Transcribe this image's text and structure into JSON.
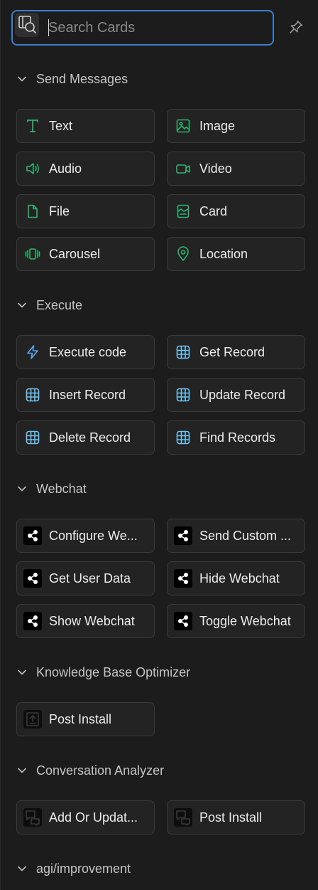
{
  "search": {
    "placeholder": "Search Cards",
    "value": ""
  },
  "colors": {
    "accent_blue": "#3b7fd1",
    "icon_green": "#2fb371",
    "icon_blue": "#5aa9f5",
    "icon_cyan": "#6ec6f5"
  },
  "sections": [
    {
      "title": "Send Messages",
      "cards": [
        {
          "label": "Text",
          "icon": "text-icon"
        },
        {
          "label": "Image",
          "icon": "image-icon"
        },
        {
          "label": "Audio",
          "icon": "audio-icon"
        },
        {
          "label": "Video",
          "icon": "video-icon"
        },
        {
          "label": "File",
          "icon": "file-icon"
        },
        {
          "label": "Card",
          "icon": "card-icon"
        },
        {
          "label": "Carousel",
          "icon": "carousel-icon"
        },
        {
          "label": "Location",
          "icon": "location-icon"
        }
      ]
    },
    {
      "title": "Execute",
      "cards": [
        {
          "label": "Execute code",
          "icon": "lightning-icon"
        },
        {
          "label": "Get Record",
          "icon": "table-icon"
        },
        {
          "label": "Insert Record",
          "icon": "table-icon"
        },
        {
          "label": "Update Record",
          "icon": "table-icon"
        },
        {
          "label": "Delete Record",
          "icon": "table-icon"
        },
        {
          "label": "Find Records",
          "icon": "table-icon"
        }
      ]
    },
    {
      "title": "Webchat",
      "cards": [
        {
          "label": "Configure We...",
          "icon": "share-icon"
        },
        {
          "label": "Send Custom ...",
          "icon": "share-icon"
        },
        {
          "label": "Get User Data",
          "icon": "share-icon"
        },
        {
          "label": "Hide Webchat",
          "icon": "share-icon"
        },
        {
          "label": "Show Webchat",
          "icon": "share-icon"
        },
        {
          "label": "Toggle Webchat",
          "icon": "share-icon"
        }
      ]
    },
    {
      "title": "Knowledge Base Optimizer",
      "cards": [
        {
          "label": "Post Install",
          "icon": "upload-icon"
        }
      ]
    },
    {
      "title": "Conversation Analyzer",
      "cards": [
        {
          "label": "Add Or Updat...",
          "icon": "chat-icon"
        },
        {
          "label": "Post Install",
          "icon": "chat-icon"
        }
      ]
    },
    {
      "title": "agi/improvement",
      "cards": []
    }
  ]
}
